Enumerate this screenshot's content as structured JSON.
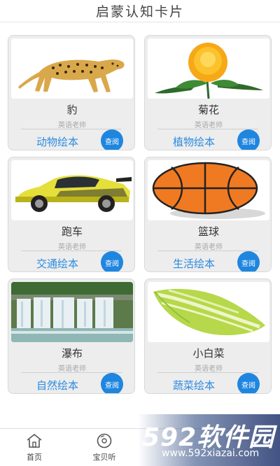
{
  "header": {
    "title": "启蒙认知卡片"
  },
  "cards": [
    {
      "name": "豹",
      "teacher": "英语老师",
      "category": "动物绘本",
      "button": "查阅",
      "image": "cheetah"
    },
    {
      "name": "菊花",
      "teacher": "英语老师",
      "category": "植物绘本",
      "button": "查阅",
      "image": "chrysanthemum"
    },
    {
      "name": "跑车",
      "teacher": "英语老师",
      "category": "交通绘本",
      "button": "查阅",
      "image": "sports-car"
    },
    {
      "name": "篮球",
      "teacher": "英语老师",
      "category": "生活绘本",
      "button": "查阅",
      "image": "basketball"
    },
    {
      "name": "瀑布",
      "teacher": "英语老师",
      "category": "自然绘本",
      "button": "查阅",
      "image": "waterfall"
    },
    {
      "name": "小白菜",
      "teacher": "英语老师",
      "category": "蔬菜绘本",
      "button": "查阅",
      "image": "bok-choy"
    }
  ],
  "tabbar": {
    "home": {
      "label": "首页",
      "icon": "home-icon"
    },
    "listen": {
      "label": "宝贝听",
      "icon": "disc-icon"
    }
  },
  "watermark": {
    "brand": "592软件园",
    "url": "www.592xiazai.com"
  },
  "colors": {
    "accent": "#1f86e0",
    "category_text": "#2a8be0"
  }
}
